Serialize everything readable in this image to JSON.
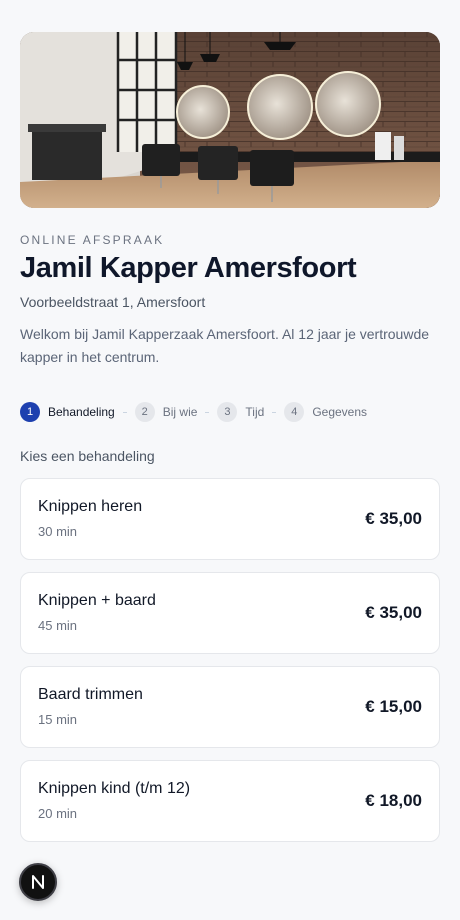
{
  "hero": {
    "image_alt": "Salon interior with round mirrors and brick wall"
  },
  "header": {
    "eyebrow": "ONLINE AFSPRAAK",
    "title": "Jamil Kapper Amersfoort",
    "address": "Voorbeeldstraat 1, Amersfoort",
    "intro": "Welkom bij Jamil Kapperzaak Amersfoort. Al 12 jaar je vertrouwde kapper in het centrum."
  },
  "steps": [
    {
      "number": "1",
      "label": "Behandeling",
      "active": true
    },
    {
      "number": "2",
      "label": "Bij wie",
      "active": false
    },
    {
      "number": "3",
      "label": "Tijd",
      "active": false
    },
    {
      "number": "4",
      "label": "Gegevens",
      "active": false
    }
  ],
  "section_label": "Kies een behandeling",
  "services": [
    {
      "name": "Knippen heren",
      "duration": "30 min",
      "price": "€ 35,00"
    },
    {
      "name": "Knippen + baard",
      "duration": "45 min",
      "price": "€ 35,00"
    },
    {
      "name": "Baard trimmen",
      "duration": "15 min",
      "price": "€ 15,00"
    },
    {
      "name": "Knippen kind (t/m 12)",
      "duration": "20 min",
      "price": "€ 18,00"
    }
  ],
  "icons": {
    "step_active": "#1e40af",
    "dev_badge": "nextjs-n-icon"
  }
}
